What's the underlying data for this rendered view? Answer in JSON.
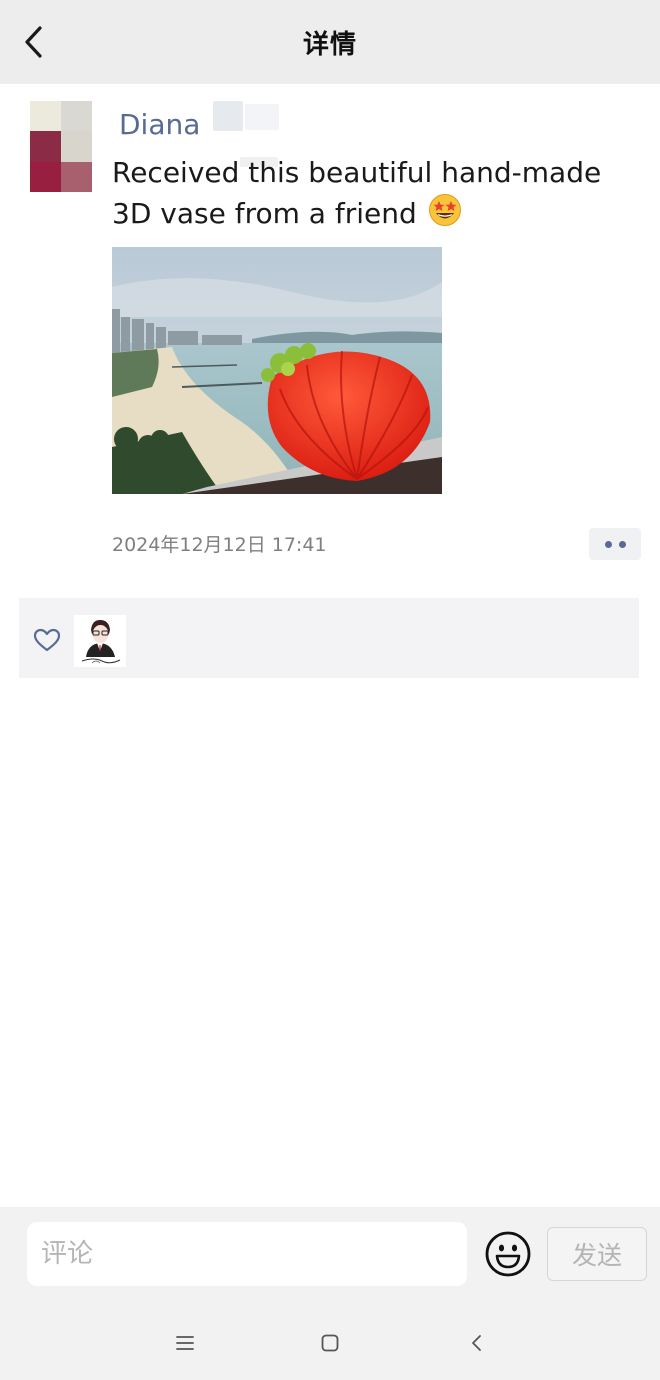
{
  "header": {
    "title": "详情",
    "back_icon": "chevron-left-icon"
  },
  "post": {
    "author": "Diana",
    "text": "Received this beautiful hand-made 3D vase from a friend",
    "emoji": "star-struck-emoji",
    "photo": "photo of a red scallop-shell shaped 3D printed vase on a balcony railing overlooking a beach",
    "timestamp": "2024年12月12日 17:41",
    "more_icon": "more-dots-icon"
  },
  "likes": {
    "icon": "heart-outline-icon",
    "likers": [
      "liker-avatar"
    ]
  },
  "comment_bar": {
    "placeholder": "评论",
    "emoji_icon": "smiley-face-icon",
    "send_label": "发送"
  },
  "system_nav": {
    "menu_icon": "menu-lines-icon",
    "home_icon": "home-square-icon",
    "back_icon": "back-chevron-icon"
  },
  "colors": {
    "header_bg": "#ededed",
    "link_blue": "#576b95",
    "panel_bg": "#f3f3f5",
    "bar_bg": "#f2f2f2"
  }
}
